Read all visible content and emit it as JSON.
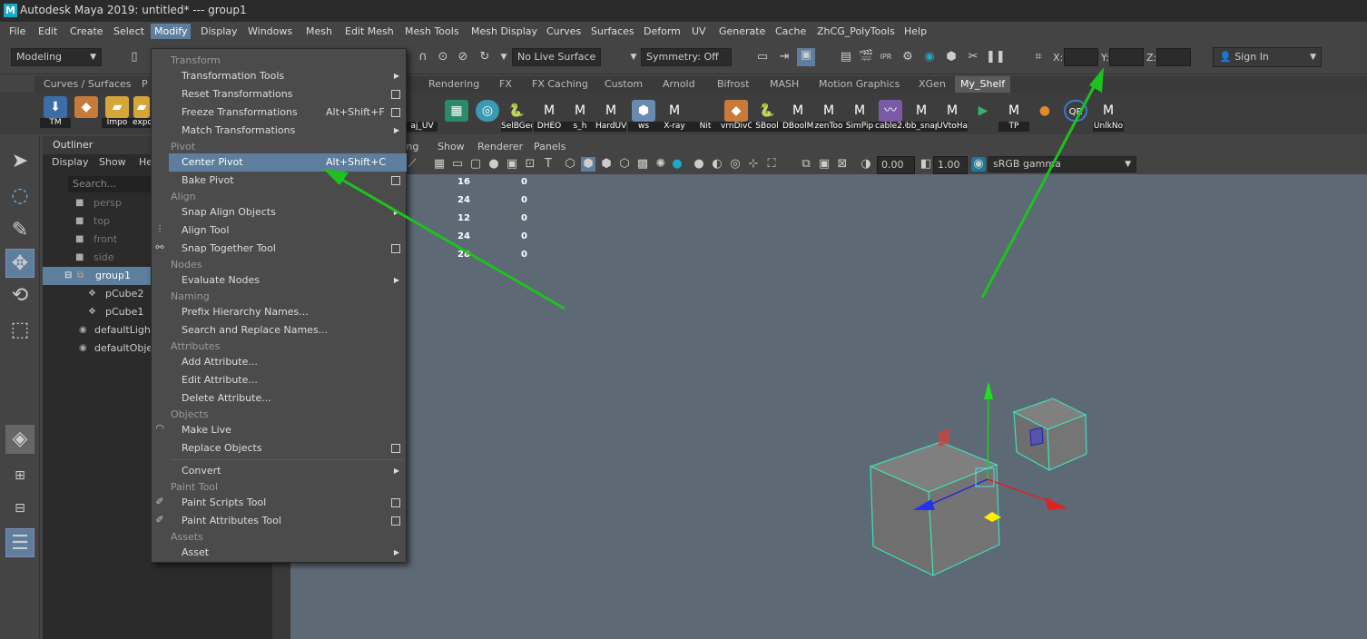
{
  "window": {
    "title": "Autodesk Maya 2019: untitled*   ---   group1",
    "logo": "M"
  },
  "menubar": [
    "File",
    "Edit",
    "Create",
    "Select",
    "Modify",
    "Display",
    "Windows",
    "Mesh",
    "Edit Mesh",
    "Mesh Tools",
    "Mesh Display",
    "Curves",
    "Surfaces",
    "Deform",
    "UV",
    "Generate",
    "Cache",
    "ZhCG_PolyTools",
    "Help"
  ],
  "toolbar": {
    "mode": "Modeling",
    "live_surface": "No Live Surface",
    "symmetry": "Symmetry: Off",
    "x_label": "X:",
    "y_label": "Y:",
    "z_label": "Z:",
    "sign_in": "Sign In"
  },
  "shelf_tabs": [
    "Curves / Surfaces",
    "P",
    "Rendering",
    "FX",
    "FX Caching",
    "Custom",
    "Arnold",
    "Bifrost",
    "MASH",
    "Motion Graphics",
    "XGen",
    "My_Shelf"
  ],
  "shelf_left": [
    {
      "label": "TM",
      "icon": "tm-icon"
    },
    {
      "label": "",
      "icon": "cubes-icon"
    },
    {
      "label": "Impo",
      "icon": "import-folder-icon"
    },
    {
      "label": "expo",
      "icon": "export-folder-icon"
    }
  ],
  "shelf_right": [
    "aj_UV",
    "",
    "SelBGeo",
    "DHEO",
    "s_h",
    "HardUV",
    "ws",
    "X-ray",
    "Nit",
    "vrnDivC",
    "SBool",
    "DBoolM",
    "zenToo",
    "SimPip",
    "cable2.0",
    "bb_snap",
    "UVtoHa",
    "",
    "TP",
    "",
    "",
    "UnlkNo"
  ],
  "outliner": {
    "title": "Outliner",
    "menu": [
      "Display",
      "Show",
      "He"
    ],
    "search_placeholder": "Search...",
    "items": [
      {
        "label": "persp",
        "icon": "camera-icon",
        "state": "dim"
      },
      {
        "label": "top",
        "icon": "camera-icon",
        "state": "dim"
      },
      {
        "label": "front",
        "icon": "camera-icon",
        "state": "dim"
      },
      {
        "label": "side",
        "icon": "camera-icon",
        "state": "dim"
      },
      {
        "label": "group1",
        "icon": "group-icon",
        "state": "selected"
      },
      {
        "label": "pCube2",
        "icon": "mesh-icon",
        "state": "normal"
      },
      {
        "label": "pCube1",
        "icon": "mesh-icon",
        "state": "normal"
      },
      {
        "label": "defaultLightSet",
        "icon": "set-icon",
        "state": "normal"
      },
      {
        "label": "defaultObjectSet",
        "icon": "set-icon",
        "state": "normal"
      }
    ]
  },
  "viewport": {
    "menu": [
      "ting",
      "Show",
      "Renderer",
      "Panels"
    ],
    "exposure": "0.00",
    "gamma": "1.00",
    "colorspace": "sRGB gamma",
    "hud_rows": [
      [
        "16",
        "0"
      ],
      [
        "24",
        "0"
      ],
      [
        "12",
        "0"
      ],
      [
        "24",
        "0"
      ],
      [
        "28",
        "0"
      ]
    ]
  },
  "modify_menu": {
    "sections": [
      {
        "title": "Transform",
        "items": [
          {
            "label": "Transformation Tools",
            "shortcut": "",
            "submenu": true,
            "option": false
          },
          {
            "label": "Reset Transformations",
            "shortcut": "",
            "submenu": false,
            "option": true
          },
          {
            "label": "Freeze Transformations",
            "shortcut": "Alt+Shift+F",
            "submenu": false,
            "option": true
          },
          {
            "label": "Match Transformations",
            "shortcut": "",
            "submenu": true,
            "option": false
          }
        ]
      },
      {
        "title": "Pivot",
        "items": [
          {
            "label": "Center Pivot",
            "shortcut": "Alt+Shift+C",
            "submenu": false,
            "option": false,
            "highlighted": true
          },
          {
            "label": "Bake Pivot",
            "shortcut": "",
            "submenu": false,
            "option": true
          }
        ]
      },
      {
        "title": "Align",
        "items": [
          {
            "label": "Snap Align Objects",
            "shortcut": "",
            "submenu": true,
            "option": false
          },
          {
            "label": "Align Tool",
            "shortcut": "",
            "submenu": false,
            "option": false
          },
          {
            "label": "Snap Together Tool",
            "shortcut": "",
            "submenu": false,
            "option": true
          }
        ]
      },
      {
        "title": "Nodes",
        "items": [
          {
            "label": "Evaluate Nodes",
            "shortcut": "",
            "submenu": true,
            "option": false
          }
        ]
      },
      {
        "title": "Naming",
        "items": [
          {
            "label": "Prefix Hierarchy Names...",
            "shortcut": "",
            "submenu": false,
            "option": false
          },
          {
            "label": "Search and Replace Names...",
            "shortcut": "",
            "submenu": false,
            "option": false
          }
        ]
      },
      {
        "title": "Attributes",
        "items": [
          {
            "label": "Add Attribute...",
            "shortcut": "",
            "submenu": false,
            "option": false
          },
          {
            "label": "Edit Attribute...",
            "shortcut": "",
            "submenu": false,
            "option": false
          },
          {
            "label": "Delete Attribute...",
            "shortcut": "",
            "submenu": false,
            "option": false
          }
        ]
      },
      {
        "title": "Objects",
        "items": [
          {
            "label": "Make Live",
            "shortcut": "",
            "submenu": false,
            "option": false
          },
          {
            "label": "Replace Objects",
            "shortcut": "",
            "submenu": false,
            "option": true
          }
        ]
      },
      {
        "title": "",
        "items": [
          {
            "label": "Convert",
            "shortcut": "",
            "submenu": true,
            "option": false
          }
        ]
      },
      {
        "title": "Paint Tool",
        "items": [
          {
            "label": "Paint Scripts Tool",
            "shortcut": "",
            "submenu": false,
            "option": true
          },
          {
            "label": "Paint Attributes Tool",
            "shortcut": "",
            "submenu": false,
            "option": true
          }
        ]
      },
      {
        "title": "Assets",
        "items": [
          {
            "label": "Asset",
            "shortcut": "",
            "submenu": true,
            "option": false
          }
        ]
      }
    ]
  },
  "colors": {
    "accent": "#5d7e9c",
    "annotation_arrow": "#1ec21e",
    "viewport_bg": "#5d6975",
    "wireframe": "#38e0b0"
  }
}
